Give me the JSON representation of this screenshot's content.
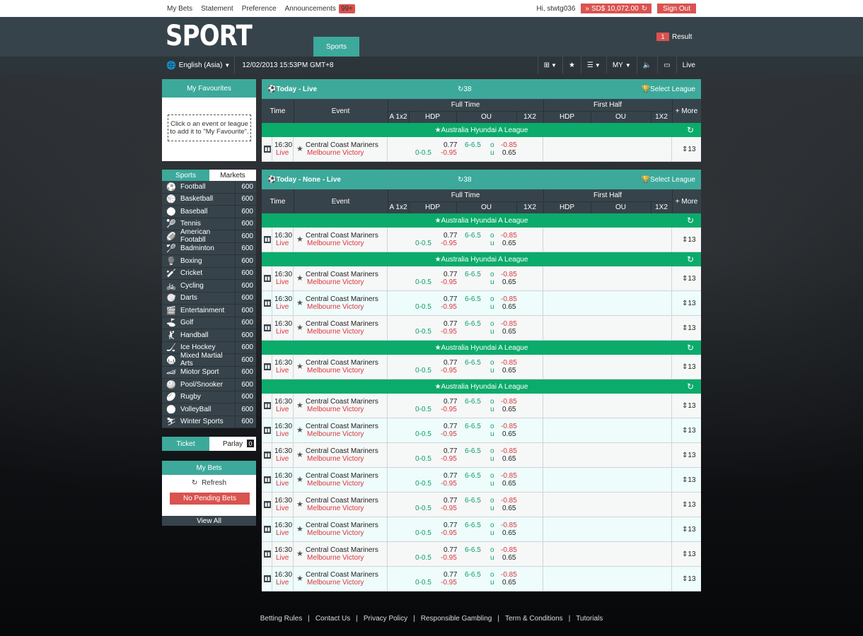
{
  "topbar": {
    "links": [
      "My Bets",
      "Statement",
      "Preference",
      "Announcements"
    ],
    "announcements_badge": "99+",
    "greeting": "Hi, stwtg036",
    "balance": "SD$  10,072.00",
    "signout": "Sign Out"
  },
  "header": {
    "logo": "SPORT",
    "tab": "Sports",
    "result_count": "1",
    "result_label": "Result"
  },
  "subbar": {
    "language": "English (Asia)",
    "datetime": "12/02/2013  15:53PM GMT+8",
    "odds_type": "MY",
    "live": "Live"
  },
  "favourites": {
    "title": "My Favourites",
    "hint": "Click o an event or league to add it to \"My Favourite\"."
  },
  "sport_tabs": {
    "sports": "Sports",
    "markets": "Markets"
  },
  "sports": [
    {
      "name": "Football",
      "count": "600",
      "icon": "⚽"
    },
    {
      "name": "Basketball",
      "count": "600",
      "icon": "🏀"
    },
    {
      "name": "Baseball",
      "count": "600",
      "icon": "⚾"
    },
    {
      "name": "Tennis",
      "count": "600",
      "icon": "🎾"
    },
    {
      "name": "American Footabll",
      "count": "600",
      "icon": "🏈"
    },
    {
      "name": "Badminton",
      "count": "600",
      "icon": "🏸"
    },
    {
      "name": "Boxing",
      "count": "600",
      "icon": "🥊"
    },
    {
      "name": "Cricket",
      "count": "600",
      "icon": "🏏"
    },
    {
      "name": "Cycling",
      "count": "600",
      "icon": "🚲"
    },
    {
      "name": "Darts",
      "count": "600",
      "icon": "🎯"
    },
    {
      "name": "Entertainment",
      "count": "600",
      "icon": "🎬"
    },
    {
      "name": "Golf",
      "count": "600",
      "icon": "⛳"
    },
    {
      "name": "Handball",
      "count": "600",
      "icon": "🤾"
    },
    {
      "name": "Ice Hockey",
      "count": "600",
      "icon": "🏒"
    },
    {
      "name": "Mixed Martial Arts",
      "count": "600",
      "icon": "🥋"
    },
    {
      "name": "Miotor Sport",
      "count": "600",
      "icon": "🏎"
    },
    {
      "name": "Pool/Snooker",
      "count": "600",
      "icon": "🎱"
    },
    {
      "name": "Rugby",
      "count": "600",
      "icon": "🏉"
    },
    {
      "name": "VolleyBall",
      "count": "600",
      "icon": "🏐"
    },
    {
      "name": "Winter Sports",
      "count": "600",
      "icon": "⛷"
    }
  ],
  "ticket_tabs": {
    "ticket": "Ticket",
    "parlay": "Parlay",
    "parlay_count": "0"
  },
  "mybets": {
    "title": "My Bets",
    "refresh": "Refresh",
    "no_pending": "No Pending Bets",
    "view_all": "View All"
  },
  "columns": {
    "time": "Time",
    "event": "Event",
    "full_time": "Full Time",
    "first_half": "First Half",
    "a1x2": "A 1x2",
    "hdp": "HDP",
    "ou": "OU",
    "x12": "1X2",
    "more": "+ More"
  },
  "league_name": "Australia Hyundai A League",
  "match": {
    "time": "16:30",
    "live": "Live",
    "home": "Central Coast Mariners",
    "away": "Melbourne Victory",
    "hdp_line": "0-0.5",
    "hdp_home": "0.77",
    "hdp_away": "-0.95",
    "ou_line": "6-6.5",
    "ou_o": "o",
    "ou_u": "u",
    "ou_over": "-0.85",
    "ou_under": "0.65",
    "more": "13"
  },
  "markets": [
    {
      "title": "Today - Live",
      "count": "38",
      "select": "Select League",
      "groups": [
        {
          "rows": [
            "plain"
          ]
        }
      ]
    },
    {
      "title": "Today - None - Live",
      "count": "38",
      "select": "Select League",
      "groups": [
        {
          "rows": [
            "plain"
          ]
        },
        {
          "rows": [
            "plain",
            "alt",
            "plain"
          ]
        },
        {
          "rows": [
            "plain"
          ]
        },
        {
          "rows": [
            "plain",
            "alt",
            "plain",
            "alt",
            "plain",
            "alt",
            "plain",
            "alt"
          ]
        }
      ]
    }
  ],
  "footer": [
    "Betting Rules",
    "Contact Us",
    "Privacy Policy",
    "Responsible Gambling",
    "Term & Conditions",
    "Tutorials"
  ]
}
